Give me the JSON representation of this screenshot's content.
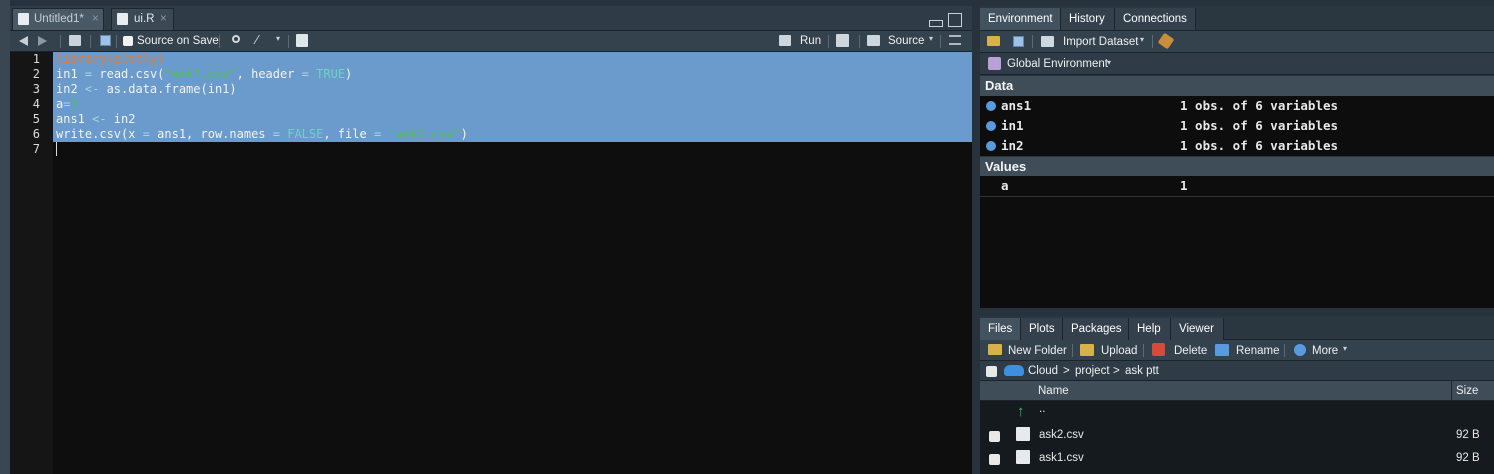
{
  "editor": {
    "tabs": [
      {
        "label": "Untitled1*",
        "close": "×"
      },
      {
        "label": "ui.R",
        "close": "×"
      }
    ],
    "toolbar": {
      "source_on_save": "Source on Save",
      "run": "Run",
      "source": "Source"
    },
    "line_numbers": [
      "1",
      "2",
      "3",
      "4",
      "5",
      "6",
      "7"
    ],
    "code": {
      "l1": {
        "a": "library",
        "b": "(plotly)"
      },
      "l2": {
        "a": "in1 ",
        "b": "=",
        "c": " read.csv(",
        "d": "\"ask1.csv\"",
        "e": ", header ",
        "f": "=",
        "g": " ",
        "h": "TRUE",
        "i": ")"
      },
      "l3": {
        "a": "in2 ",
        "b": "<-",
        "c": " as.data.frame(in1)"
      },
      "l4": {
        "a": "a",
        "b": "=",
        "c": "1"
      },
      "l5": {
        "a": "ans1 ",
        "b": "<-",
        "c": " in2"
      },
      "l6": {
        "a": "write.csv(x ",
        "b": "=",
        "c": " ans1, row.names ",
        "d": "=",
        "e": " ",
        "f": "FALSE",
        "g": ", file ",
        "h": "=",
        "i": " ",
        "j": "\"ask2.csv\"",
        "k": ")"
      }
    }
  },
  "environment": {
    "tabs": [
      "Environment",
      "History",
      "Connections"
    ],
    "import_dataset": "Import Dataset",
    "scope": "Global Environment",
    "data_header": "Data",
    "data_rows": [
      {
        "name": "ans1",
        "value": "1 obs. of 6 variables"
      },
      {
        "name": "in1",
        "value": "1 obs. of 6 variables"
      },
      {
        "name": "in2",
        "value": "1 obs. of 6 variables"
      }
    ],
    "values_header": "Values",
    "value_rows": [
      {
        "name": "a",
        "value": "1"
      }
    ]
  },
  "files": {
    "tabs": [
      "Files",
      "Plots",
      "Packages",
      "Help",
      "Viewer"
    ],
    "toolbar": {
      "new_folder": "New Folder",
      "upload": "Upload",
      "delete": "Delete",
      "rename": "Rename",
      "more": "More"
    },
    "breadcrumb": [
      "Cloud",
      "project",
      "ask ptt"
    ],
    "columns": {
      "name": "Name",
      "size": "Size"
    },
    "up_label": "..",
    "rows": [
      {
        "name": "ask2.csv",
        "size": "92 B"
      },
      {
        "name": "ask1.csv",
        "size": "92 B"
      }
    ]
  },
  "colors": {
    "selection": "#6a9bcc",
    "string": "#4fc24f",
    "keyword": "#6fd1c9",
    "library": "#e27c39",
    "background": "#0e0e0e"
  }
}
